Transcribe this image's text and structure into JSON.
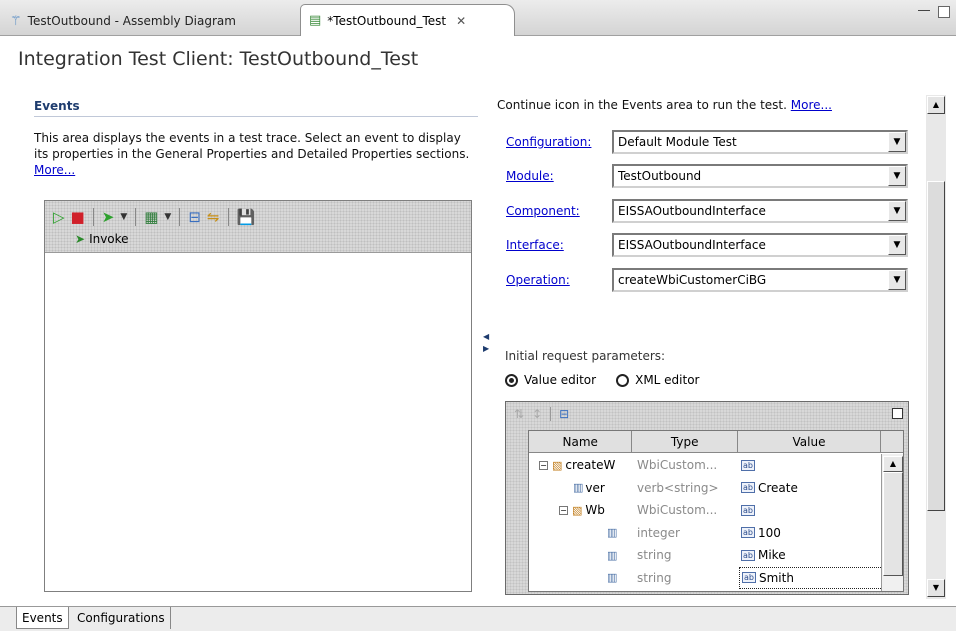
{
  "tabs": [
    {
      "label": "TestOutbound - Assembly Diagram",
      "icon": "assembly-diagram-icon"
    },
    {
      "label": "*TestOutbound_Test",
      "icon": "test-document-icon",
      "close": "✕"
    }
  ],
  "page_title": "Integration Test Client: TestOutbound_Test",
  "events": {
    "title": "Events",
    "description": "This area displays the events in a test trace. Select an event to display its properties in the General Properties and Detailed Properties sections.",
    "more_link": "More...",
    "trace_item": "Invoke"
  },
  "continue_text": "Continue icon in the Events area to run the test.",
  "continue_more": "More...",
  "form": {
    "configuration": {
      "label": "Configuration:",
      "value": "Default Module Test"
    },
    "module": {
      "label": "Module:",
      "value": "TestOutbound"
    },
    "component": {
      "label": "Component:",
      "value": "EISSAOutboundInterface"
    },
    "interface": {
      "label": "Interface:",
      "value": "EISSAOutboundInterface"
    },
    "operation": {
      "label": "Operation:",
      "value": "createWbiCustomerCiBG"
    }
  },
  "initial_request_label": "Initial request parameters:",
  "editor_options": [
    {
      "label": "Value editor",
      "selected": true
    },
    {
      "label": "XML editor",
      "selected": false
    }
  ],
  "table": {
    "columns": [
      "Name",
      "Type",
      "Value"
    ],
    "rows": [
      {
        "name": "createW",
        "type": "WbiCustom...",
        "value": "",
        "kind": "node",
        "indent": 0,
        "toggle": "−"
      },
      {
        "name": "ver",
        "type": "verb<string>",
        "value": "Create",
        "kind": "leaf",
        "indent": 1
      },
      {
        "name": "Wb",
        "type": "WbiCustom...",
        "value": "",
        "kind": "node",
        "indent": 1,
        "toggle": "−"
      },
      {
        "name": "",
        "type": "integer",
        "value": "100",
        "kind": "leaf",
        "indent": 2
      },
      {
        "name": "",
        "type": "string",
        "value": "Mike",
        "kind": "leaf",
        "indent": 2
      },
      {
        "name": "",
        "type": "string",
        "value": "Smith",
        "kind": "leaf",
        "indent": 2,
        "selected": true
      }
    ]
  },
  "bottom_tabs": [
    "Events",
    "Configurations"
  ]
}
